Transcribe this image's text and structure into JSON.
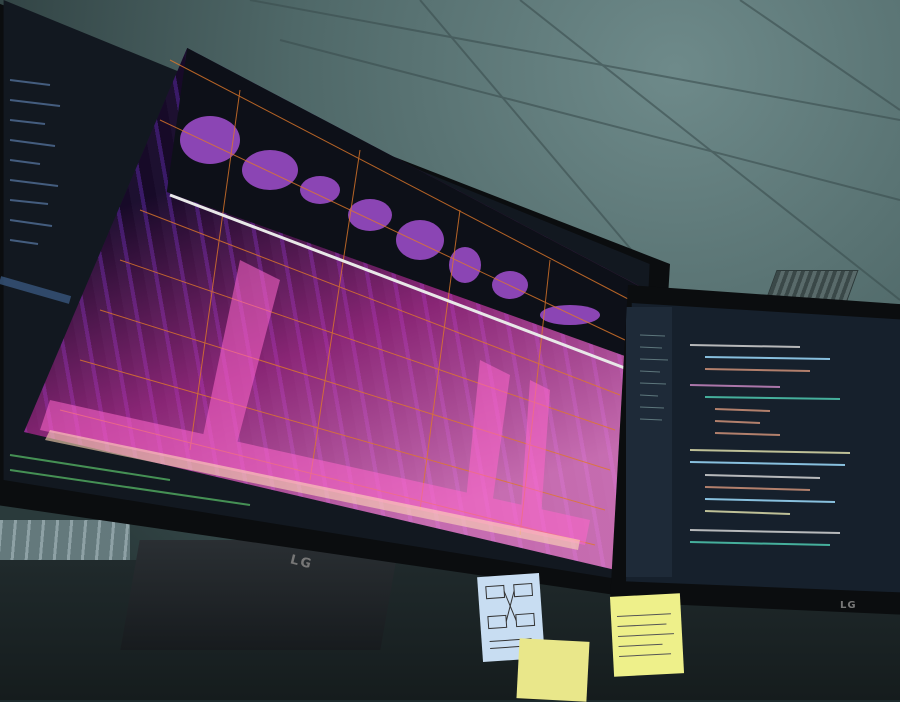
{
  "scene": {
    "description_free": true,
    "left_monitor": {
      "brand": "LG",
      "content": "spectrogram-and-waveform",
      "accent": "#d94fd0"
    },
    "right_monitor": {
      "brand": "LG",
      "content": "code-editor"
    },
    "colors": {
      "ceiling": "#5e7878",
      "spectrogram_low": "#1a0b30",
      "spectrogram_high": "#ff8ce0",
      "grid": "#e0782a",
      "waveform": "#b25ddc",
      "editor_bg": "#16202c"
    }
  }
}
